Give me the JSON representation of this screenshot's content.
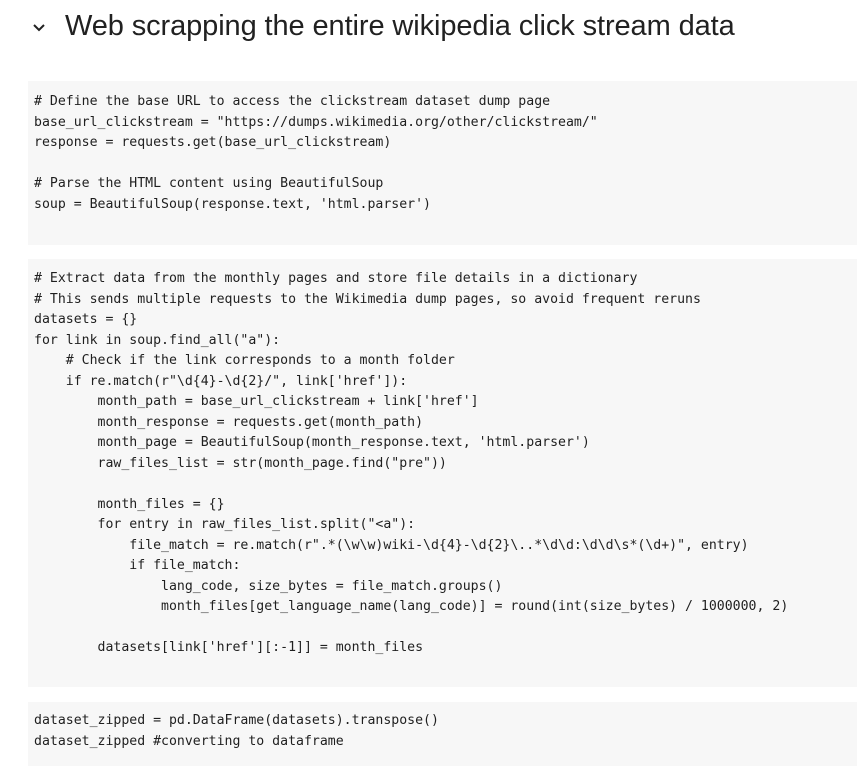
{
  "section": {
    "icon": "chevron-down-icon",
    "title": "Web scrapping the entire wikipedia click stream data"
  },
  "cells": [
    {
      "lines": [
        "# Define the base URL to access the clickstream dataset dump page",
        "base_url_clickstream = \"https://dumps.wikimedia.org/other/clickstream/\"",
        "response = requests.get(base_url_clickstream)",
        "",
        "# Parse the HTML content using BeautifulSoup",
        "soup = BeautifulSoup(response.text, 'html.parser')"
      ]
    },
    {
      "lines": [
        "# Extract data from the monthly pages and store file details in a dictionary",
        "# This sends multiple requests to the Wikimedia dump pages, so avoid frequent reruns",
        "datasets = {}",
        "for link in soup.find_all(\"a\"):",
        "    # Check if the link corresponds to a month folder",
        "    if re.match(r\"\\d{4}-\\d{2}/\", link['href']):",
        "        month_path = base_url_clickstream + link['href']",
        "        month_response = requests.get(month_path)",
        "        month_page = BeautifulSoup(month_response.text, 'html.parser')",
        "        raw_files_list = str(month_page.find(\"pre\"))",
        "",
        "        month_files = {}",
        "        for entry in raw_files_list.split(\"<a\"):",
        "            file_match = re.match(r\".*(\\w\\w)wiki-\\d{4}-\\d{2}\\..*\\d\\d:\\d\\d\\s*(\\d+)\", entry)",
        "            if file_match:",
        "                lang_code, size_bytes = file_match.groups()",
        "                month_files[get_language_name(lang_code)] = round(int(size_bytes) / 1000000, 2)",
        "",
        "        datasets[link['href'][:-1]] = month_files"
      ]
    },
    {
      "lines": [
        "dataset_zipped = pd.DataFrame(datasets).transpose()",
        "dataset_zipped #converting to dataframe"
      ]
    }
  ]
}
